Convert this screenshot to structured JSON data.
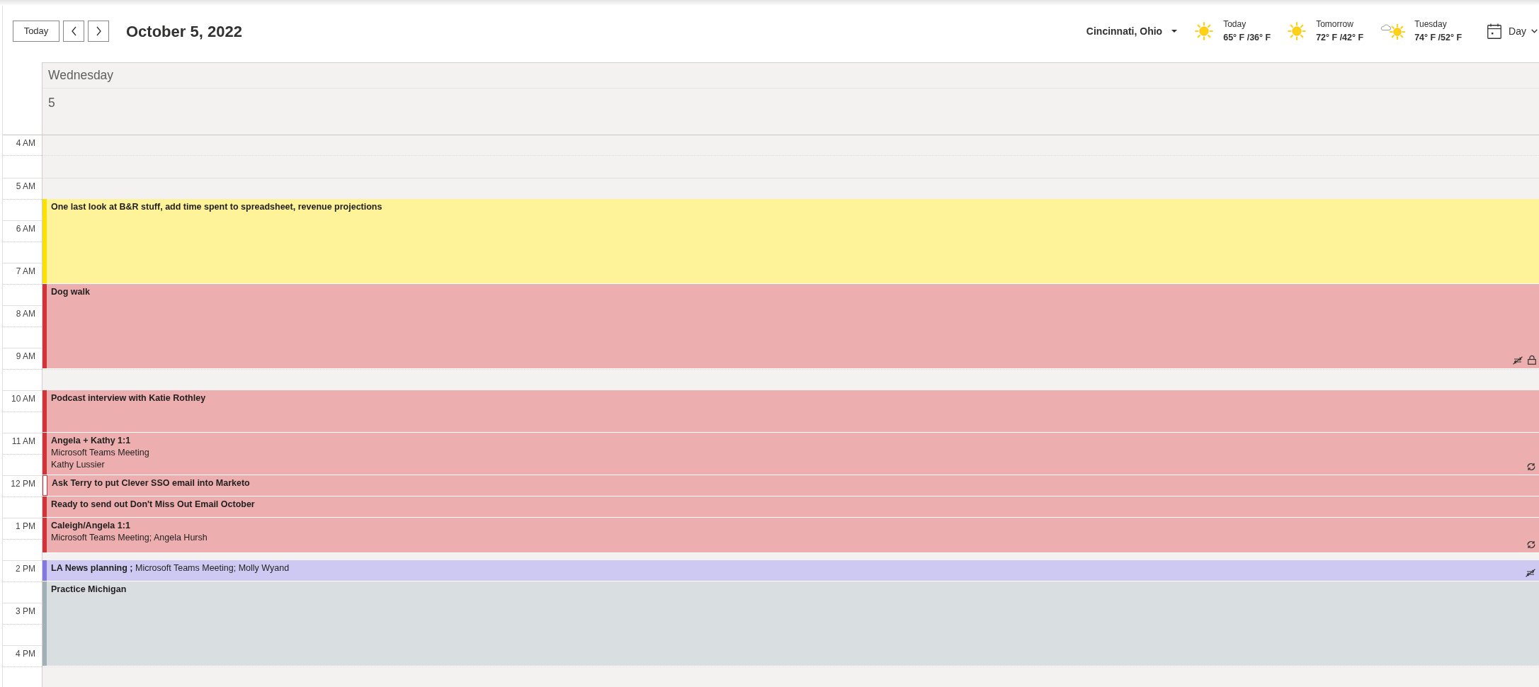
{
  "toolbar": {
    "today_button": "Today",
    "title": "October 5, 2022",
    "location": "Cincinnati, Ohio",
    "forecast": [
      {
        "day": "Today",
        "temps": "65° F /36° F",
        "kind": "sunny"
      },
      {
        "day": "Tomorrow",
        "temps": "72° F /42° F",
        "kind": "sunny"
      },
      {
        "day": "Tuesday",
        "temps": "74° F /52° F",
        "kind": "partly-sunny"
      }
    ],
    "view": "Day"
  },
  "day_header": {
    "weekday": "Wednesday",
    "date": "5"
  },
  "time_labels": [
    "4 AM",
    "5 AM",
    "6 AM",
    "7 AM",
    "8 AM",
    "9 AM",
    "10 AM",
    "11 AM",
    "12 PM",
    "1 PM",
    "2 PM",
    "3 PM",
    "4 PM"
  ],
  "events": [
    {
      "kind": "stacked",
      "title": "One last look at B&R stuff, add time spent to spreadsheet, revenue projections",
      "color": "#fce100",
      "busy": true,
      "recurring": false,
      "exception": false,
      "private": false
    },
    {
      "kind": "stacked",
      "title": "Dog walk",
      "color": "#d13438",
      "busy": true,
      "recurring": true,
      "exception": true,
      "private": true
    },
    {
      "kind": "stacked",
      "title": "Podcast interview with Katie Rothley",
      "color": "#d13438",
      "busy": true,
      "recurring": false,
      "exception": false,
      "private": false
    },
    {
      "kind": "stacked",
      "title": "Angela + Kathy 1:1",
      "details": [
        "Microsoft Teams Meeting",
        "Kathy Lussier"
      ],
      "color": "#d13438",
      "busy": true,
      "recurring": true,
      "exception": false,
      "private": false
    },
    {
      "kind": "stacked",
      "title": "Ask Terry to put Clever SSO email into Marketo",
      "color": "#d13438",
      "busy": false,
      "recurring": false,
      "exception": false,
      "private": false
    },
    {
      "kind": "stacked",
      "title": "Ready to send out Don't Miss Out Email October",
      "color": "#d13438",
      "busy": true,
      "recurring": false,
      "exception": false,
      "private": false
    },
    {
      "kind": "stacked",
      "title": "Caleigh/Angela 1:1",
      "details": [
        "Microsoft Teams Meeting; Angela Hursh"
      ],
      "color": "#d13438",
      "busy": true,
      "recurring": true,
      "exception": false,
      "private": false
    },
    {
      "kind": "inline",
      "text": "**LA News planning ;** Microsoft Teams Meeting; Molly Wyand",
      "color": "#8378de",
      "busy": true,
      "recurring": true,
      "exception": true,
      "private": false
    },
    {
      "kind": "stacked",
      "title": "Practice Michigan",
      "color": "#a1b0b4",
      "busy": true,
      "recurring": false,
      "exception": false,
      "private": false
    }
  ]
}
